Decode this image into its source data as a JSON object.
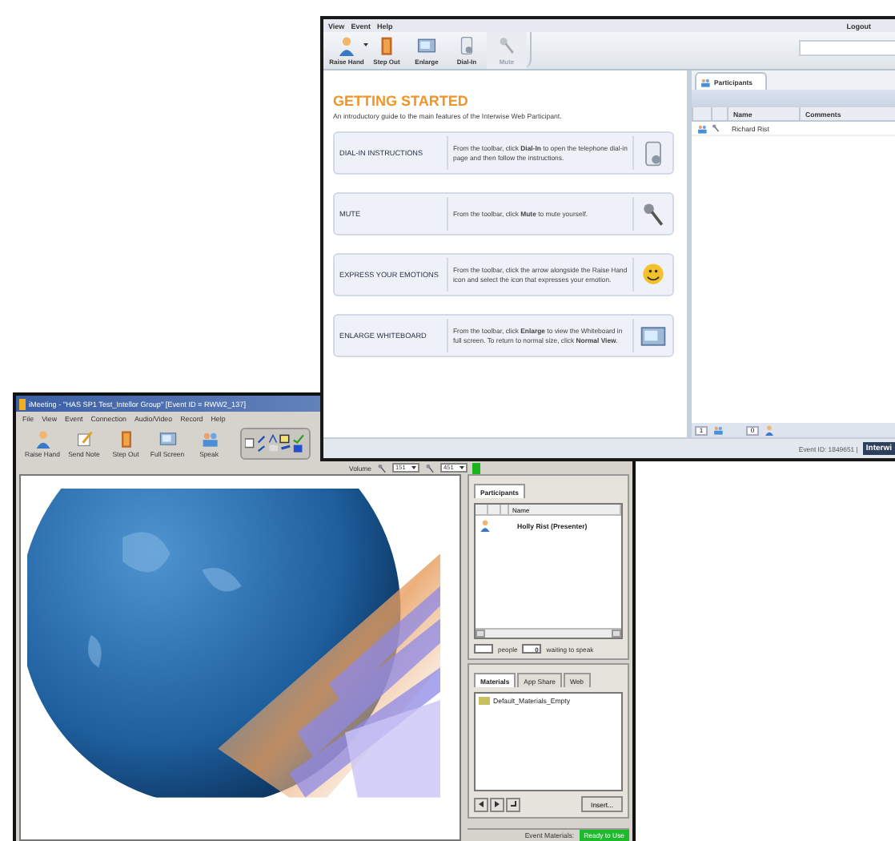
{
  "web_window": {
    "menu": [
      "View",
      "Event",
      "Help"
    ],
    "logout": "Logout",
    "toolbar": [
      {
        "label": "Raise Hand",
        "kind": "person",
        "disabled": false,
        "dropdown": true
      },
      {
        "label": "Step Out",
        "kind": "door",
        "disabled": false,
        "dropdown": false
      },
      {
        "label": "Enlarge",
        "kind": "screen",
        "disabled": false,
        "dropdown": false
      },
      {
        "label": "Dial-In",
        "kind": "phone",
        "disabled": false,
        "dropdown": false
      },
      {
        "label": "Mute",
        "kind": "mic",
        "disabled": true,
        "dropdown": false
      }
    ],
    "heading": "GETTING STARTED",
    "intro": "An introductory guide to the main features of the Interwise Web Participant.",
    "cards": [
      {
        "title": "DIAL-IN INSTRUCTIONS",
        "text": "From the toolbar, click **Dial-In** to open the telephone dial-in page and then follow the instructions.",
        "kind": "phone"
      },
      {
        "title": "MUTE",
        "text": "From the toolbar, click **Mute** to mute yourself.",
        "kind": "mic"
      },
      {
        "title": "EXPRESS YOUR EMOTIONS",
        "text": "From the toolbar, click the arrow alongside the Raise Hand icon and select the icon that expresses your emotion.",
        "kind": "smiley"
      },
      {
        "title": "ENLARGE WHITEBOARD",
        "text": "From the toolbar, click **Enlarge** to view the Whiteboard in full screen. To return to normal size, click **Normal View**.",
        "kind": "screen"
      }
    ],
    "participants_tab": {
      "label": "Participants",
      "selected": true
    },
    "columns": [
      "Name",
      "Comments"
    ],
    "participants": [
      {
        "name": "Richard Rist"
      }
    ],
    "counters": [
      "1",
      "0"
    ],
    "event_id": "Event ID: 1849651 |",
    "brand": "Interwi"
  },
  "meeting_window": {
    "title": "iMeeting - \"HAS SP1 Test_Intellor Group\" [Event ID = RWW2_137]",
    "menu": [
      "File",
      "View",
      "Event",
      "Connection",
      "Audio/Video",
      "Record",
      "Help"
    ],
    "toolbar": [
      {
        "label": "Raise Hand",
        "kind": "person"
      },
      {
        "label": "Send Note",
        "kind": "note"
      },
      {
        "label": "Step Out",
        "kind": "door"
      },
      {
        "label": "Full Screen",
        "kind": "screen"
      },
      {
        "label": "Speak",
        "kind": "people"
      }
    ],
    "volume_label": "Volume",
    "volume_values": [
      "151",
      "451"
    ],
    "participants_tab": {
      "label": "Participants",
      "selected": true
    },
    "participant_columns": [
      "Name"
    ],
    "participants": [
      {
        "name": "Holly Rist (Presenter)"
      }
    ],
    "people_label": "people",
    "waiting_count": "0",
    "waiting_label": "waiting to speak",
    "material_tabs": [
      {
        "label": "Materials",
        "selected": true
      },
      {
        "label": "App Share",
        "selected": false
      },
      {
        "label": "Web",
        "selected": false
      }
    ],
    "materials": [
      "Default_Materials_Empty"
    ],
    "insert_button": "Insert...",
    "status_label": "Event Materials:",
    "status_value": "Ready to Use"
  }
}
